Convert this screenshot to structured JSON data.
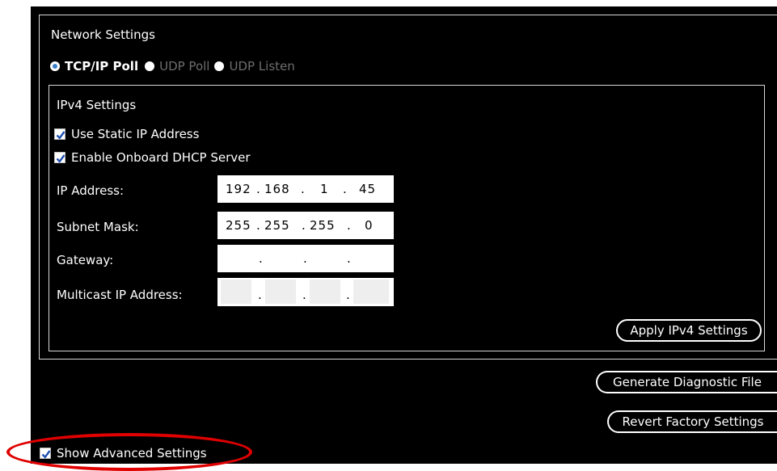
{
  "network": {
    "title": "Network Settings",
    "modes": [
      {
        "label": "TCP/IP Poll",
        "selected": true
      },
      {
        "label": "UDP Poll",
        "selected": false
      },
      {
        "label": "UDP Listen",
        "selected": false
      }
    ]
  },
  "ipv4": {
    "title": "IPv4 Settings",
    "use_static": {
      "label": "Use Static IP Address",
      "checked": true
    },
    "enable_dhcp": {
      "label": "Enable Onboard DHCP Server",
      "checked": true
    },
    "ip_address": {
      "label": "IP Address:",
      "octets": [
        "192",
        "168",
        "1",
        "45"
      ]
    },
    "subnet_mask": {
      "label": "Subnet Mask:",
      "octets": [
        "255",
        "255",
        "255",
        "0"
      ]
    },
    "gateway": {
      "label": "Gateway:",
      "octets": [
        "",
        "",
        "",
        ""
      ]
    },
    "multicast": {
      "label": "Multicast IP Address:",
      "octets": [
        "",
        "",
        "",
        ""
      ]
    },
    "separator": ".",
    "apply_label": "Apply IPv4 Settings"
  },
  "actions": {
    "diagnostic_label": "Generate Diagnostic File",
    "revert_label": "Revert Factory Settings"
  },
  "advanced": {
    "label": "Show Advanced Settings",
    "checked": true
  },
  "colors": {
    "background": "#000000",
    "text": "#ffffff",
    "disabled_text": "#6e6e6e",
    "highlight": "#e00000",
    "check": "#1e4fb0"
  }
}
